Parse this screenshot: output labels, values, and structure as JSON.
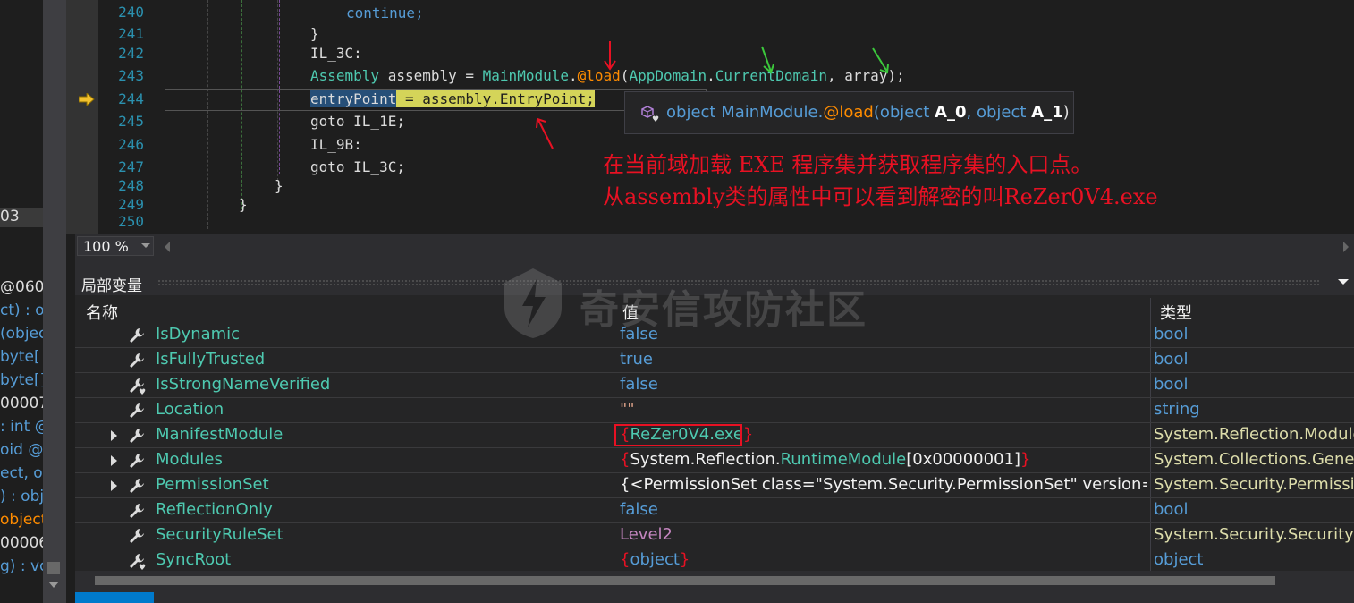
{
  "left_panel": {
    "rows": [
      {
        "text": "03"
      },
      {
        "text": "@060"
      },
      {
        "text": "ct) : o"
      },
      {
        "text": "(objec"
      },
      {
        "text": " byte["
      },
      {
        "text": "byte[]"
      },
      {
        "text": "00007"
      },
      {
        "text": ": int @"
      },
      {
        "text": "oid @"
      },
      {
        "text": "ect, ob"
      },
      {
        "text": ") : obj"
      },
      {
        "text": "object(o"
      },
      {
        "text": "00006"
      },
      {
        "text": "g) : vo"
      }
    ]
  },
  "editor": {
    "line_numbers": [
      "240",
      "241",
      "242",
      "243",
      "244",
      "245",
      "246",
      "247",
      "248",
      "249",
      "250"
    ],
    "lines": {
      "l240": "continue;",
      "l241": "}",
      "l242": "IL_3C:",
      "l243_a": "Assembly",
      "l243_b": " assembly = ",
      "l243_c": "MainModule",
      "l243_d": ".",
      "l243_e": "@load",
      "l243_f": "(",
      "l243_g": "AppDomain",
      "l243_h": ".",
      "l243_i": "CurrentDomain",
      "l243_j": ", array);",
      "l244_a": "entryPoint",
      "l244_b": " = assembly.EntryPoint;",
      "l245": "goto IL_1E;",
      "l246": "IL_9B:",
      "l247": "goto IL_3C;",
      "l248": "}",
      "l249": "}"
    },
    "zoom": "100 %"
  },
  "tooltip": {
    "prefix": "object MainModule.",
    "method": "@load",
    "open": "(object ",
    "arg0": "A_0",
    "mid": ", object ",
    "arg1": "A_1",
    "close": ")"
  },
  "annotations": {
    "line1": "在当前域加载 EXE 程序集并获取程序集的入口点。",
    "line2": "从assembly类的属性中可以看到解密的叫ReZer0V4.exe"
  },
  "locals": {
    "title": "局部变量",
    "columns": {
      "name": "名称",
      "value": "值",
      "type": "类型"
    },
    "rows": [
      {
        "name": "IsDynamic",
        "value": "false",
        "type": "bool"
      },
      {
        "name": "IsFullyTrusted",
        "value": "true",
        "type": "bool"
      },
      {
        "name": "IsStrongNameVerified",
        "value": "false",
        "type": "bool"
      },
      {
        "name": "Location",
        "value": "\"\"",
        "type": "string"
      },
      {
        "name": "ManifestModule",
        "value": "ReZer0V4.exe",
        "type": "System.Reflection.Module"
      },
      {
        "name": "Modules",
        "value_a": "System.Reflection.",
        "value_b": "RuntimeModule",
        "value_c": "[0x00000001]",
        "type": "System.Collections.Generic"
      },
      {
        "name": "PermissionSet",
        "value": "{<PermissionSet class=\"System.Security.PermissionSet\"  version=\"...",
        "type": "System.Security.Permission"
      },
      {
        "name": "ReflectionOnly",
        "value": "false",
        "type": "bool"
      },
      {
        "name": "SecurityRuleSet",
        "value": "Level2",
        "type": "System.Security.SecurityRu"
      },
      {
        "name": "SyncRoot",
        "value": "object",
        "type": "object"
      }
    ]
  },
  "watermark": {
    "text": "奇安信攻防社区"
  },
  "colors": {
    "annotation_red": "#e81123",
    "arrow_green": "#3cc83c",
    "keyword_blue": "#569cd6",
    "type_teal": "#4ec9b0"
  }
}
